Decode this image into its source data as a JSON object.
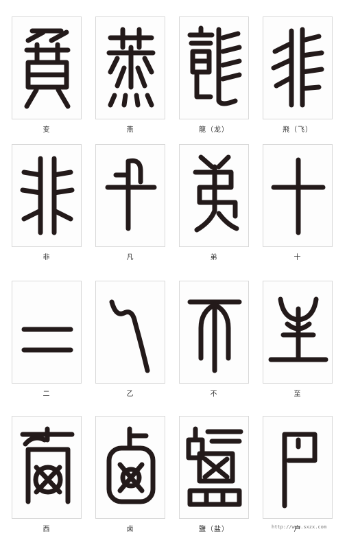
{
  "sheet": {
    "captions": [
      "变",
      "燕",
      "龍（龙）",
      "飛（飞）",
      "非",
      "凡",
      "弟",
      "十",
      "二",
      "乙",
      "不",
      "至",
      "西",
      "卤",
      "鹽（盐）",
      "户"
    ],
    "watermark": "http://www.sxzx.com"
  },
  "colors": {
    "ink": "#231a1a",
    "panel_border": "#d8d8d8",
    "caption_text": "#333333"
  }
}
